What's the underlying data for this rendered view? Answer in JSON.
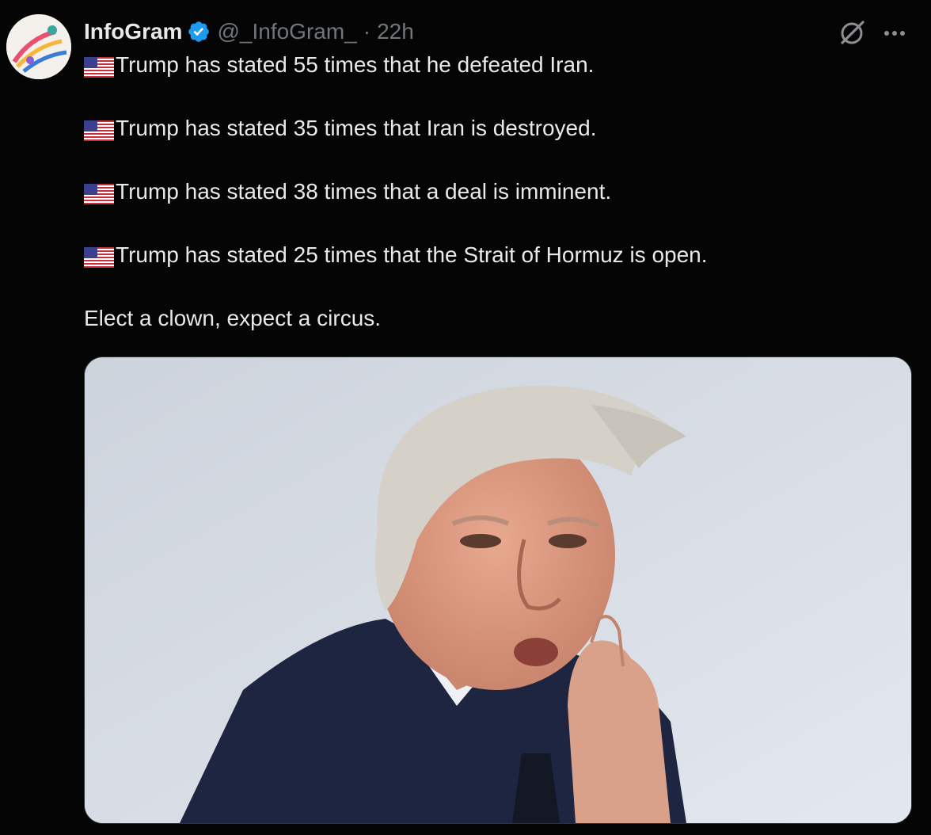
{
  "author": {
    "display_name": "InfoGram",
    "handle": "@_InfoGram_",
    "separator": "·",
    "time": "22h",
    "avatar_icon": "infogram-logo-avatar",
    "verified_icon": "verified-badge-icon",
    "verified_color": "#1d9bf0"
  },
  "tweet": {
    "lines": [
      {
        "prefix_icon": "us-flag-icon",
        "text": "Trump has stated 55 times that he defeated Iran."
      },
      {
        "prefix_icon": "us-flag-icon",
        "text": "Trump has stated 35 times that Iran is destroyed."
      },
      {
        "prefix_icon": "us-flag-icon",
        "text": "Trump has stated 38 times that a deal is imminent."
      },
      {
        "prefix_icon": "us-flag-icon",
        "text": "Trump has stated 25 times that the Strait of Hormuz is open."
      },
      {
        "prefix_icon": "",
        "text": "Elect a clown, expect a circus."
      }
    ]
  },
  "actions": {
    "grok_icon": "grok-icon",
    "more_icon": "more-options-icon"
  },
  "media": {
    "icon": "photo-man-in-suit-whispering"
  },
  "colors": {
    "background": "#050505",
    "text_primary": "#e7e9ea",
    "text_secondary": "#71767b",
    "border": "#2f3336"
  }
}
